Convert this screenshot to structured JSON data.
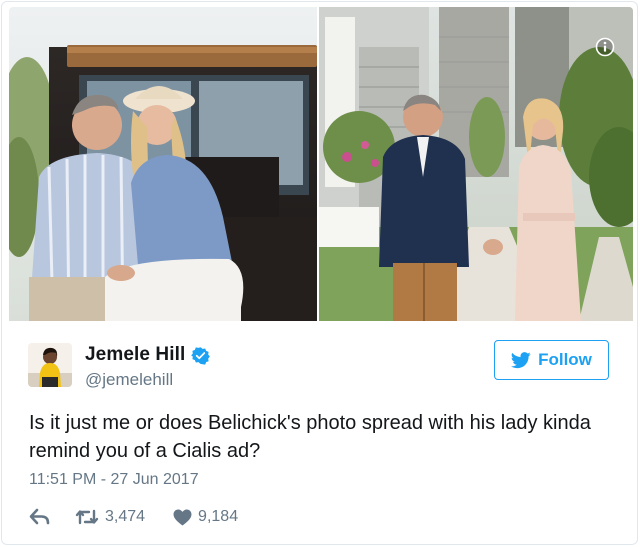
{
  "tweet": {
    "author": {
      "name": "Jemele Hill",
      "handle": "@jemelehill",
      "verified_icon": "verified-badge-icon",
      "avatar": "avatar-photo"
    },
    "follow_button": {
      "label": "Follow",
      "icon": "twitter-bird-icon"
    },
    "text": "Is it just me or does Belichick's photo spread with his lady kinda remind you of a Cialis ad?",
    "timestamp": "11:51 PM - 27 Jun 2017",
    "actions": {
      "reply": {
        "icon": "reply-icon"
      },
      "retweet": {
        "icon": "retweet-icon",
        "count": "3,474"
      },
      "like": {
        "icon": "heart-icon",
        "count": "9,184"
      }
    },
    "media": {
      "photos": [
        "couple-seated-on-vehicle-tailgate-photo",
        "couple-walking-hand-in-hand-photo"
      ],
      "info_icon": "info-icon"
    }
  },
  "colors": {
    "accent": "#1da1f2",
    "text_primary": "#14171a",
    "text_secondary": "#657786",
    "border": "#e1e8ed"
  }
}
